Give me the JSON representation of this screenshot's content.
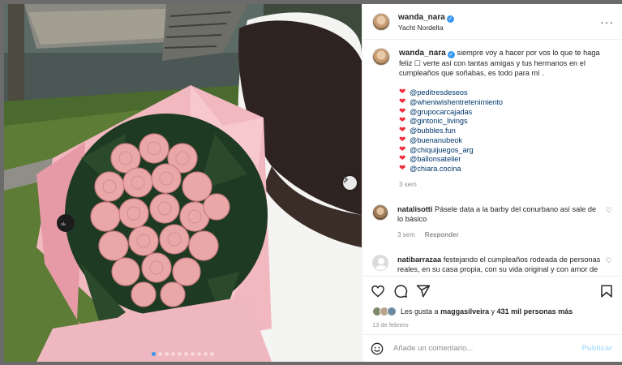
{
  "post": {
    "author": "wanda_nara",
    "location": "Yacht Nordelta",
    "more_icon": "more-horizontal-icon",
    "caption": {
      "username": "wanda_nara",
      "text": "siempre voy a hacer por vos lo que te haga feliz ☐ verte así con tantas amigas y tus hermanos en el cumpleaños que soñabas, es todo para mí .",
      "tags": [
        "@peditresdeseos",
        "@wheniwishentretenimiento",
        "@grupocarcajadas",
        "@gintonic_livings",
        "@bubbles.fun",
        "@buenanubeok",
        "@chiquijuegos_arg",
        "@ballonsatelier",
        "@chiara.cocina"
      ],
      "tag_prefix": "❤",
      "time": "3 sem"
    },
    "comments": [
      {
        "username": "natalisotti",
        "text": "Pásele data a la barby del conurbano así sale de lo básico",
        "time": "3 sem",
        "reply_label": "Responder"
      },
      {
        "username": "natibarrazaa",
        "text": "festejando el cumpleaños rodeada de personas reales, en su casa propia, con su vida original y con amor de familia. Que mejor? mamá siempre reparo lo que no rompió. Feliz cumpleaños franchu",
        "emoji": "❤"
      }
    ],
    "likes": {
      "prefix": "Les gusta a",
      "user": "maggasilveira",
      "joiner": "y",
      "count": "431 mil personas más"
    },
    "date": "13 de febrero",
    "add_comment": {
      "placeholder": "Añade un comentario...",
      "publish_label": "Publicar"
    },
    "carousel": {
      "total": 10,
      "active": 0
    },
    "colors": {
      "link": "#00376b",
      "verified": "#3797f0",
      "heart": "#ed2f3c",
      "publish": "#b2dffc"
    }
  }
}
